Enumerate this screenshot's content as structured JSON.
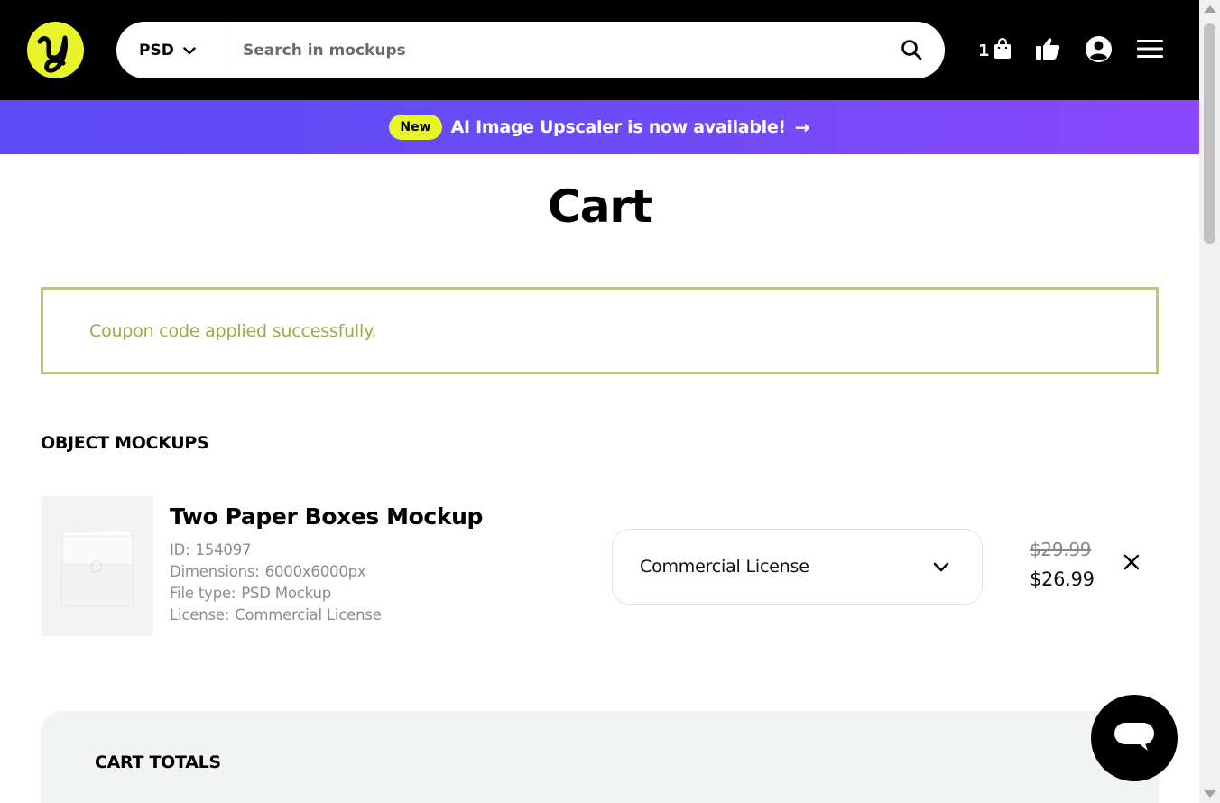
{
  "header": {
    "search_type": "PSD",
    "search_placeholder": "Search in mockups",
    "cart_count": "1"
  },
  "banner": {
    "badge": "New",
    "text": "AI Image Upscaler is now available!",
    "arrow": "→"
  },
  "page": {
    "title": "Cart",
    "notice": "Coupon code applied successfully.",
    "section_title": "OBJECT MOCKUPS"
  },
  "item": {
    "name": "Two Paper Boxes Mockup",
    "id_label": "ID:",
    "id_value": "154097",
    "dimensions_label": "Dimensions:",
    "dimensions_value": "6000x6000px",
    "filetype_label": "File type:",
    "filetype_value": "PSD Mockup",
    "license_label": "License:",
    "license_value": "Commercial License",
    "license_select": "Commercial License",
    "price_old": "$29.99",
    "price_new": "$26.99"
  },
  "totals": {
    "title": "CART TOTALS"
  },
  "colors": {
    "accent_yellow": "#e9f52b",
    "banner_purple": "#6b4cf7",
    "notice_green": "#98ad44"
  },
  "icons": [
    "logo-icon",
    "chevron-down-icon",
    "search-icon",
    "shopping-bag-icon",
    "thumbs-up-icon",
    "user-icon",
    "menu-icon",
    "close-icon",
    "chat-icon"
  ]
}
